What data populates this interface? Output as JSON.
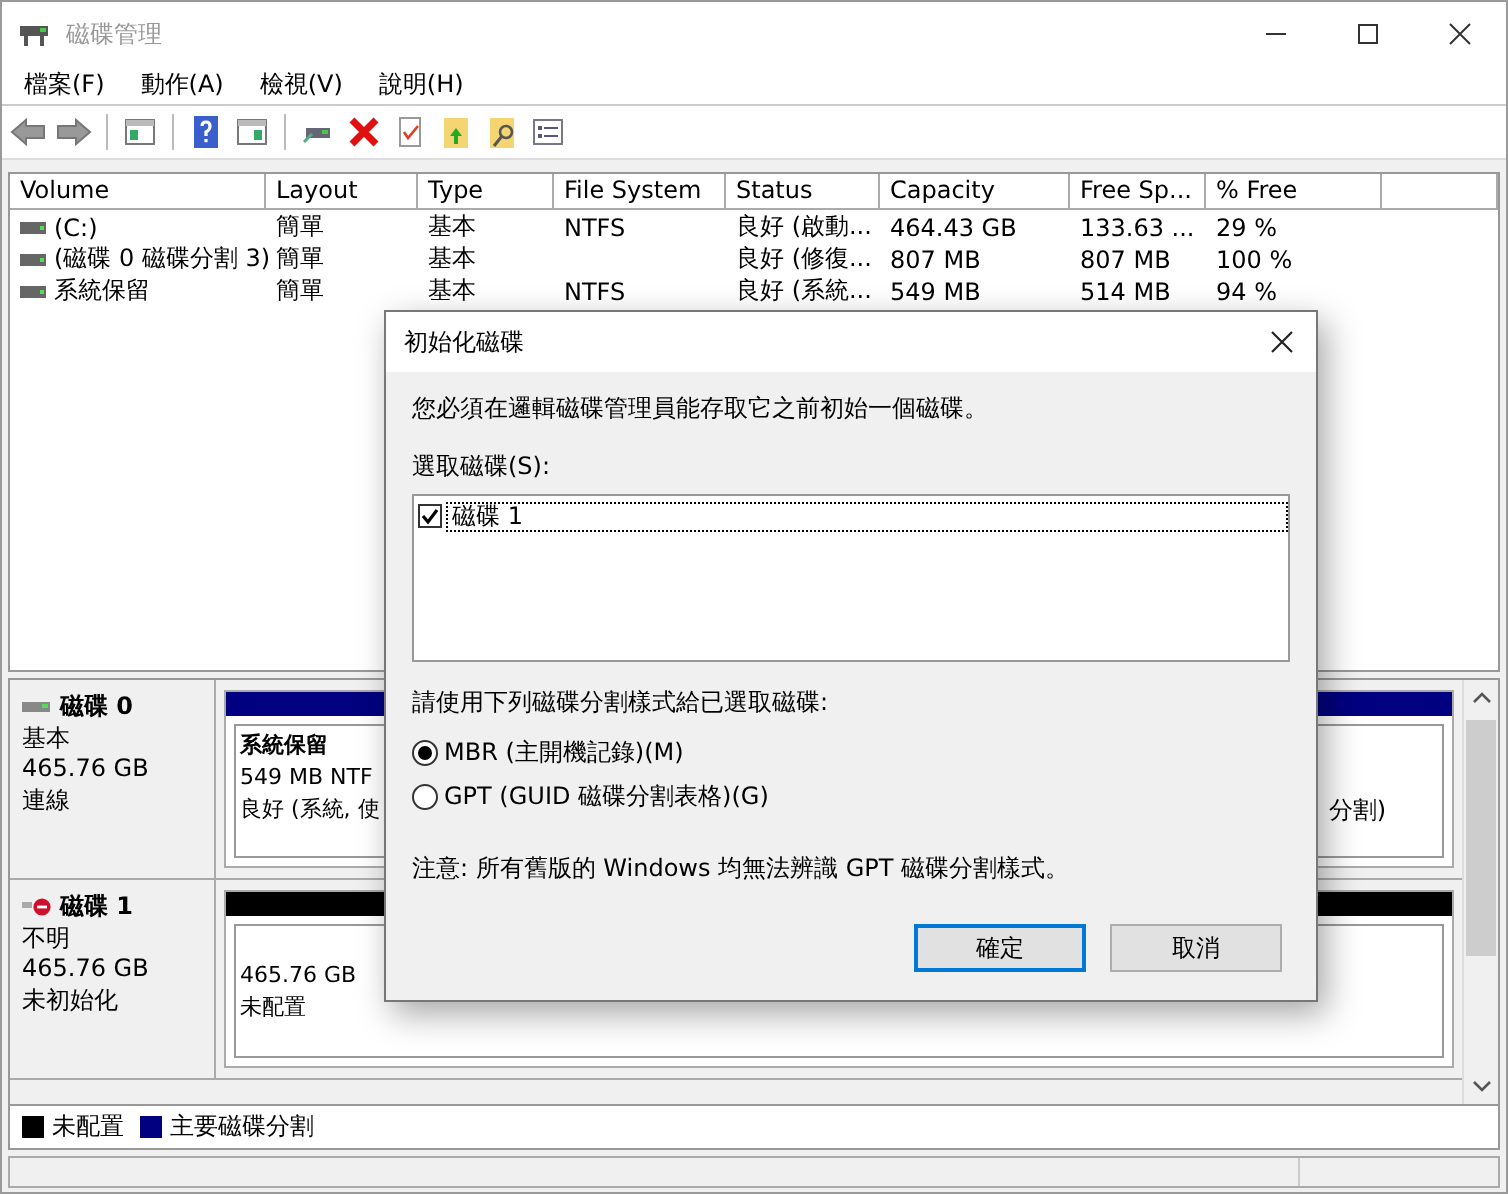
{
  "window": {
    "title": "磁碟管理"
  },
  "menu": [
    {
      "label": "檔案(F)"
    },
    {
      "label": "動作(A)"
    },
    {
      "label": "檢視(V)"
    },
    {
      "label": "說明(H)"
    }
  ],
  "volumes": {
    "columns": [
      "Volume",
      "Layout",
      "Type",
      "File System",
      "Status",
      "Capacity",
      "Free Sp...",
      "% Free"
    ],
    "rows": [
      {
        "cells": [
          "(C:)",
          "簡單",
          "基本",
          "NTFS",
          "良好 (啟動...",
          "464.43 GB",
          "133.63 ...",
          "29 %"
        ]
      },
      {
        "cells": [
          "(磁碟 0 磁碟分割 3)",
          "簡單",
          "基本",
          "",
          "良好 (修復...",
          "807 MB",
          "807 MB",
          "100 %"
        ]
      },
      {
        "cells": [
          "系統保留",
          "簡單",
          "基本",
          "NTFS",
          "良好 (系統...",
          "549 MB",
          "514 MB",
          "94 %"
        ]
      }
    ]
  },
  "disks": [
    {
      "name": "磁碟 0",
      "type": "基本",
      "size": "465.76 GB",
      "status": "連線",
      "kind": "online",
      "partitions": [
        {
          "kind": "primary",
          "lines": [
            "系統保留",
            "549 MB NTF",
            "良好 (系統, 使"
          ]
        },
        {
          "kind": "primary",
          "lines": [
            "分割)"
          ]
        }
      ]
    },
    {
      "name": "磁碟 1",
      "type": "不明",
      "size": "465.76 GB",
      "status": "未初始化",
      "kind": "error",
      "partitions": [
        {
          "kind": "unallocated",
          "lines": [
            "465.76 GB",
            "未配置"
          ]
        }
      ]
    }
  ],
  "legend": [
    {
      "label": "未配置",
      "color": "#000000"
    },
    {
      "label": "主要磁碟分割",
      "color": "#000080"
    }
  ],
  "dialog": {
    "title": "初始化磁碟",
    "message": "您必須在邏輯磁碟管理員能存取它之前初始一個磁碟。",
    "list_label": "選取磁碟(S):",
    "disks": [
      {
        "label": "磁碟 1",
        "checked": true
      }
    ],
    "style_label": "請使用下列磁碟分割樣式給已選取磁碟:",
    "options": [
      {
        "label": "MBR (主開機記錄)(M)",
        "selected": true
      },
      {
        "label": "GPT (GUID 磁碟分割表格)(G)",
        "selected": false
      }
    ],
    "note": "注意: 所有舊版的 Windows 均無法辨識 GPT 磁碟分割樣式。",
    "buttons": [
      {
        "label": "確定",
        "default": true
      },
      {
        "label": "取消",
        "default": false
      }
    ]
  }
}
